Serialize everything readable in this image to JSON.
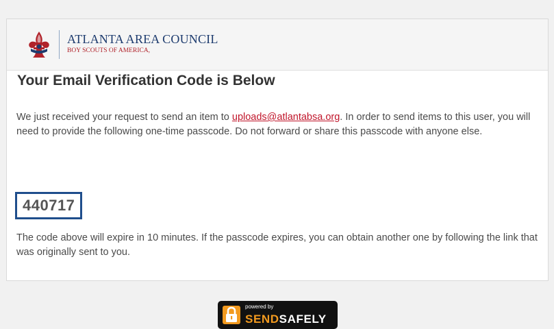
{
  "header": {
    "org_name": "ATLANTA AREA COUNCIL",
    "org_subtitle": "BOY SCOUTS OF AMERICA,",
    "logo_icon": "boy-scouts-fleur-de-lis-icon"
  },
  "main": {
    "heading": "Your Email Verification Code is Below",
    "para1_before": "We just received your request to send an item to ",
    "recipient_email": "uploads@atlantabsa.org",
    "para1_after": ". In order to send items to this user, you will need to provide the following one-time passcode. Do not forward or share this passcode with anyone else.",
    "passcode": "440717",
    "para2": "The code above will expire in 10 minutes. If the passcode expires, you can obtain another one by following the link that was originally sent to you."
  },
  "footer": {
    "badge_small": "powered by",
    "badge_brand_a": "SEND",
    "badge_brand_b": "SAFELY",
    "badge_icon": "padlock-icon"
  },
  "colors": {
    "background": "#f1f1f1",
    "link": "#c0152a",
    "passcode_border": "#1f4e8c",
    "brand_navy": "#1d3b6e",
    "badge_orange": "#f29a1f"
  }
}
